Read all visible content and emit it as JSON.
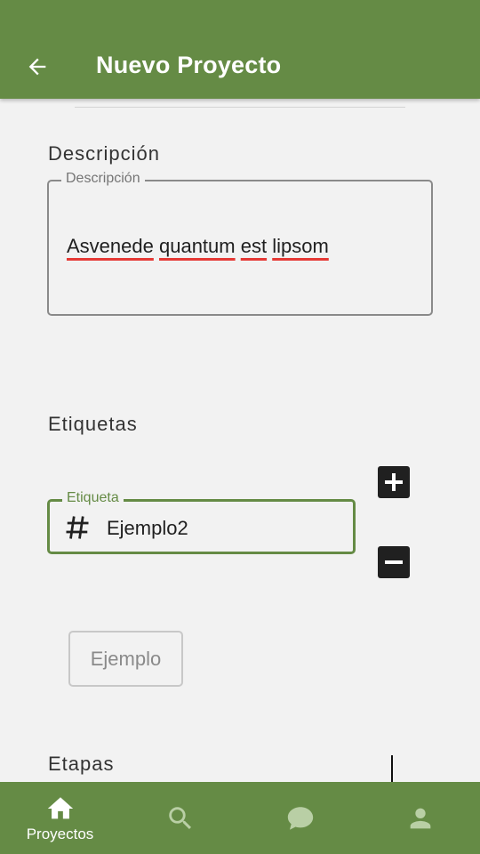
{
  "appbar": {
    "title": "Nuevo Proyecto",
    "back_icon": "arrow-left-icon",
    "color": "#658b45"
  },
  "description_section": {
    "title": "Descripción",
    "field_label": "Descripción",
    "words": [
      "Asvenede",
      "quantum",
      "est",
      "lipsom"
    ]
  },
  "tags_section": {
    "title": "Etiquetas",
    "field_label": "Etiqueta",
    "field_value": "Ejemplo2",
    "prefix_icon": "hash-icon",
    "add_icon": "plus-icon",
    "remove_icon": "minus-icon",
    "chip_label": "Ejemplo"
  },
  "stages_section": {
    "title": "Etapas"
  },
  "bottom_nav": {
    "items": [
      {
        "icon": "home-icon",
        "label": "Proyectos",
        "active": true
      },
      {
        "icon": "search-icon",
        "label": "",
        "active": false
      },
      {
        "icon": "chat-icon",
        "label": "",
        "active": false
      },
      {
        "icon": "person-icon",
        "label": "",
        "active": false
      }
    ]
  }
}
